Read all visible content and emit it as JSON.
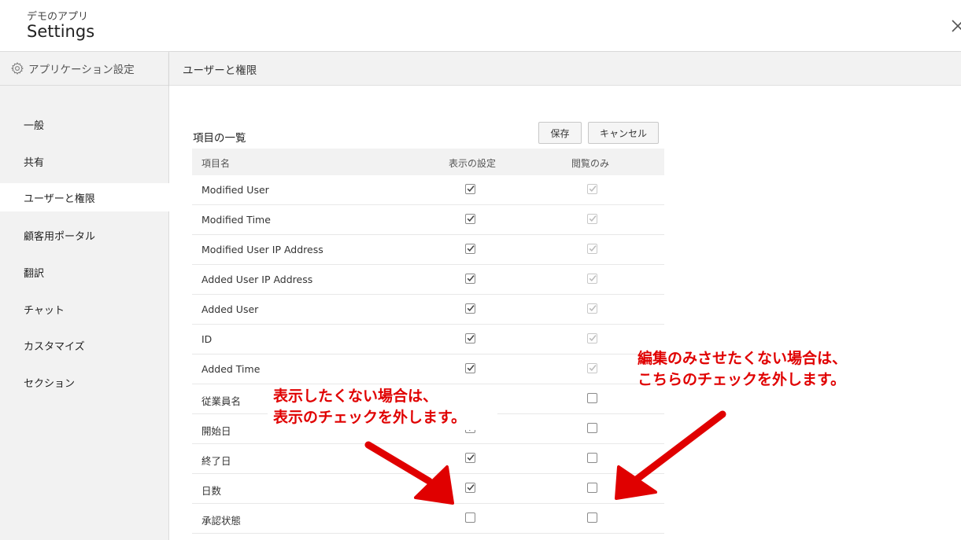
{
  "header": {
    "app_name": "デモのアプリ",
    "title": "Settings",
    "close_icon": "close-icon"
  },
  "sidebar": {
    "heading": "アプリケーション設定",
    "heading_icon": "gear-icon",
    "items": [
      {
        "label": "一般",
        "active": false
      },
      {
        "label": "共有",
        "active": false
      },
      {
        "label": "ユーザーと権限",
        "active": true
      },
      {
        "label": "顧客用ポータル",
        "active": false
      },
      {
        "label": "翻訳",
        "active": false
      },
      {
        "label": "チャット",
        "active": false
      },
      {
        "label": "カスタマイズ",
        "active": false
      },
      {
        "label": "セクション",
        "active": false
      }
    ]
  },
  "main": {
    "section_title": "ユーザーと権限",
    "list_title": "項目の一覧",
    "save_label": "保存",
    "cancel_label": "キャンセル",
    "columns": [
      "項目名",
      "表示の設定",
      "閲覧のみ"
    ],
    "rows": [
      {
        "name": "Modified User",
        "show": true,
        "readonly": true,
        "readonly_disabled": true
      },
      {
        "name": "Modified Time",
        "show": true,
        "readonly": true,
        "readonly_disabled": true
      },
      {
        "name": "Modified User IP Address",
        "show": true,
        "readonly": true,
        "readonly_disabled": true
      },
      {
        "name": "Added User IP Address",
        "show": true,
        "readonly": true,
        "readonly_disabled": true
      },
      {
        "name": "Added User",
        "show": true,
        "readonly": true,
        "readonly_disabled": true
      },
      {
        "name": "ID",
        "show": true,
        "readonly": true,
        "readonly_disabled": true
      },
      {
        "name": "Added Time",
        "show": true,
        "readonly": true,
        "readonly_disabled": true
      },
      {
        "name": "従業員名",
        "show": true,
        "readonly": false,
        "readonly_disabled": false
      },
      {
        "name": "開始日",
        "show": true,
        "readonly": false,
        "readonly_disabled": false
      },
      {
        "name": "終了日",
        "show": true,
        "readonly": false,
        "readonly_disabled": false
      },
      {
        "name": "日数",
        "show": true,
        "readonly": false,
        "readonly_disabled": false
      },
      {
        "name": "承認状態",
        "show": false,
        "readonly": false,
        "readonly_disabled": false
      }
    ]
  },
  "annotations": {
    "left_line1": "表示したくない場合は、",
    "left_line2": "表示のチェックを外します。",
    "right_line1": "編集のみさせたくない場合は、",
    "right_line2": "こちらのチェックを外します。",
    "color": "#e00000"
  }
}
